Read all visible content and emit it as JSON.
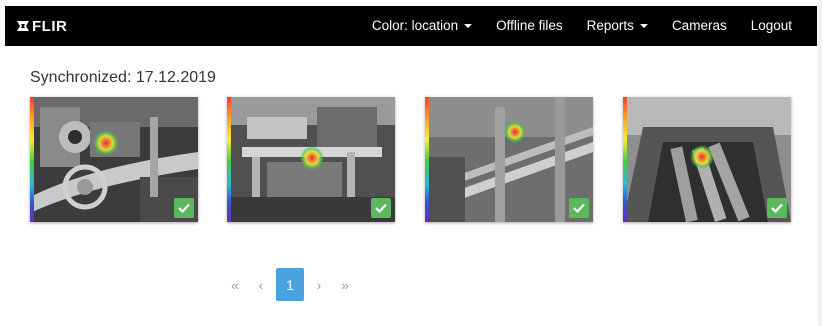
{
  "navbar": {
    "brand": "FLIR",
    "items": [
      {
        "label": "Color: location",
        "dropdown": true
      },
      {
        "label": "Offline files",
        "dropdown": false
      },
      {
        "label": "Reports",
        "dropdown": true
      },
      {
        "label": "Cameras",
        "dropdown": false
      },
      {
        "label": "Logout",
        "dropdown": false
      }
    ]
  },
  "heading": "Synchronized: 17.12.2019",
  "thumbnails": [
    {
      "status": "synced",
      "status_icon": "check-icon"
    },
    {
      "status": "synced",
      "status_icon": "check-icon"
    },
    {
      "status": "synced",
      "status_icon": "check-icon"
    },
    {
      "status": "synced",
      "status_icon": "check-icon"
    }
  ],
  "pagination": {
    "first": "«",
    "prev": "‹",
    "current": "1",
    "next": "›",
    "last": "»"
  },
  "colors": {
    "navbar_bg": "#000000",
    "check_badge": "#5cb85c",
    "active_page": "#4aa3df",
    "disabled_page": "#9a9a9a"
  }
}
